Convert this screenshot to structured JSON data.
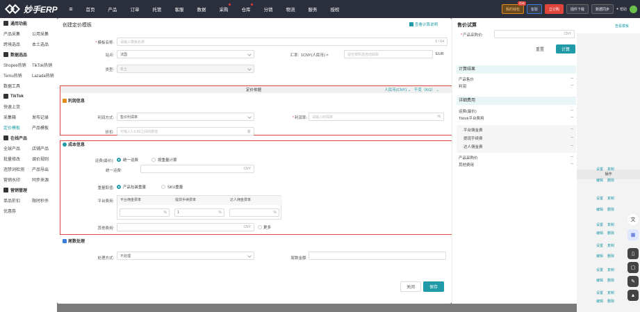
{
  "topbar": {
    "logo": "妙手ERP",
    "nav": [
      "首页",
      "产品",
      "订单",
      "托管",
      "客服",
      "数据",
      "采购",
      "仓库",
      "分销",
      "物流",
      "服务",
      "授权"
    ],
    "nav_dots": [
      "采购",
      "仓库"
    ],
    "promo": "我的钱包",
    "promo_tag": "活动",
    "other_btn": "客服",
    "red_btn": "立订购",
    "plugin": "插件下载",
    "sync": "数据同步",
    "help": "帮助"
  },
  "sidebar": {
    "sections": [
      {
        "title": "通用功能",
        "rows": [
          [
            "产品采集",
            "公用采集"
          ],
          [
            "跨境选品",
            "本土选品"
          ]
        ]
      },
      {
        "title": "数据选品",
        "rows": [
          [
            "Shopee热销",
            "TikTok热销"
          ],
          [
            "Temu热销",
            "Lazada热销"
          ]
        ]
      },
      {
        "single": "数据工具"
      },
      {
        "title": "TikTok",
        "rows": []
      },
      {
        "single": "快速上货"
      },
      {
        "rows": [
          [
            "采集箱",
            "发布记录"
          ],
          [
            "定价模板",
            "产品模板"
          ]
        ]
      },
      {
        "title": "在线产品",
        "rows": [
          [
            "全球产品",
            "店铺产品"
          ],
          [
            "批量修改",
            "调价规则"
          ],
          [
            "违禁词检测",
            "产品导出"
          ],
          [
            "营销水印",
            "同步来源"
          ]
        ]
      },
      {
        "title": "营销管理",
        "rows": [
          [
            "单品折扣",
            "限时秒杀"
          ]
        ]
      },
      {
        "single": "优惠券"
      }
    ]
  },
  "background": {
    "top_link": "查看模板",
    "ops_header": "操作",
    "row_actions": [
      "设置",
      "复制",
      "编辑",
      "删除"
    ]
  },
  "modal": {
    "title": "创建定价模板",
    "guide_link": "查看计算说明",
    "template_name_label": "模板名称:",
    "template_name_placeholder": "请输入模板名称",
    "template_name_count": "0 / 64",
    "site_label": "站点:",
    "site_value": "法国",
    "exchange_label": "汇率:",
    "exchange_base": "1CNY(人民币) ≈",
    "exchange_placeholder": "留空按所选自动获取",
    "exchange_unit": "EUR",
    "type_label": "类型:",
    "type_value": "本土",
    "pricebar_center": "定价依据",
    "pricebar_currency": "人民币(CNY)",
    "pricebar_weight": "千克（KG）",
    "profit_section": "利润信息",
    "profit_method_label": "利润方式:",
    "profit_method_value": "售价利润率",
    "profit_rate_label": "利润率:",
    "profit_rate_placeholder": "请输入利润率",
    "profit_rate_unit": "%",
    "discount_label": "折扣:",
    "discount_placeholder": "可输入1-9.99之间的数值",
    "discount_unit": "折",
    "cost_section": "成本信息",
    "freight_label": "运费(最价):",
    "freight_uniform": "统一运费",
    "freight_by_weight": "按重量计算",
    "uniform_freight_label": "统一运费:",
    "uniform_freight_unit": "CNY",
    "weight_label": "重量取值:",
    "weight_product": "产品包装重量",
    "weight_sku": "SKU重量",
    "platform_fee_label": "平台费用:",
    "fee_headers": [
      "平台佣金费率",
      "提现手续费率",
      "达人佣金费率"
    ],
    "fee_values": [
      "",
      "1",
      ""
    ],
    "fee_unit": "%",
    "other_fee_label": "其他费用:",
    "other_fee_unit": "CNY",
    "more_label": "更多",
    "tail_section": "尾数处理",
    "tail_method_label": "处理方式:",
    "tail_method_value": "不处理",
    "tail_amount_label": "尾数金额:",
    "close_button": "关闭",
    "save_button": "保存"
  },
  "calc": {
    "title": "售价试算",
    "purchase_label": "产品采购价:",
    "purchase_unit": "CNY",
    "reset_button": "重置",
    "calc_button": "计算",
    "result_band": "计算结果",
    "result_rows": [
      [
        "产品售价",
        "--"
      ],
      [
        "利润",
        "--"
      ]
    ],
    "detail_band": "详细费用",
    "detail_rows": [
      [
        "运费(最价)",
        "--"
      ],
      [
        "Tiktok平台费用",
        "--"
      ]
    ],
    "fee_rows": [
      [
        "平台佣金费",
        "--"
      ],
      [
        "提现手续费",
        "--"
      ],
      [
        "达人佣金费",
        "--"
      ]
    ],
    "tail_rows": [
      [
        "产品采购价",
        "--"
      ],
      [
        "其他费用",
        "--"
      ]
    ]
  },
  "colors": {
    "accent": "#1f9aa6",
    "topbar": "#2b2e3b",
    "highlight": "#e0453b"
  }
}
